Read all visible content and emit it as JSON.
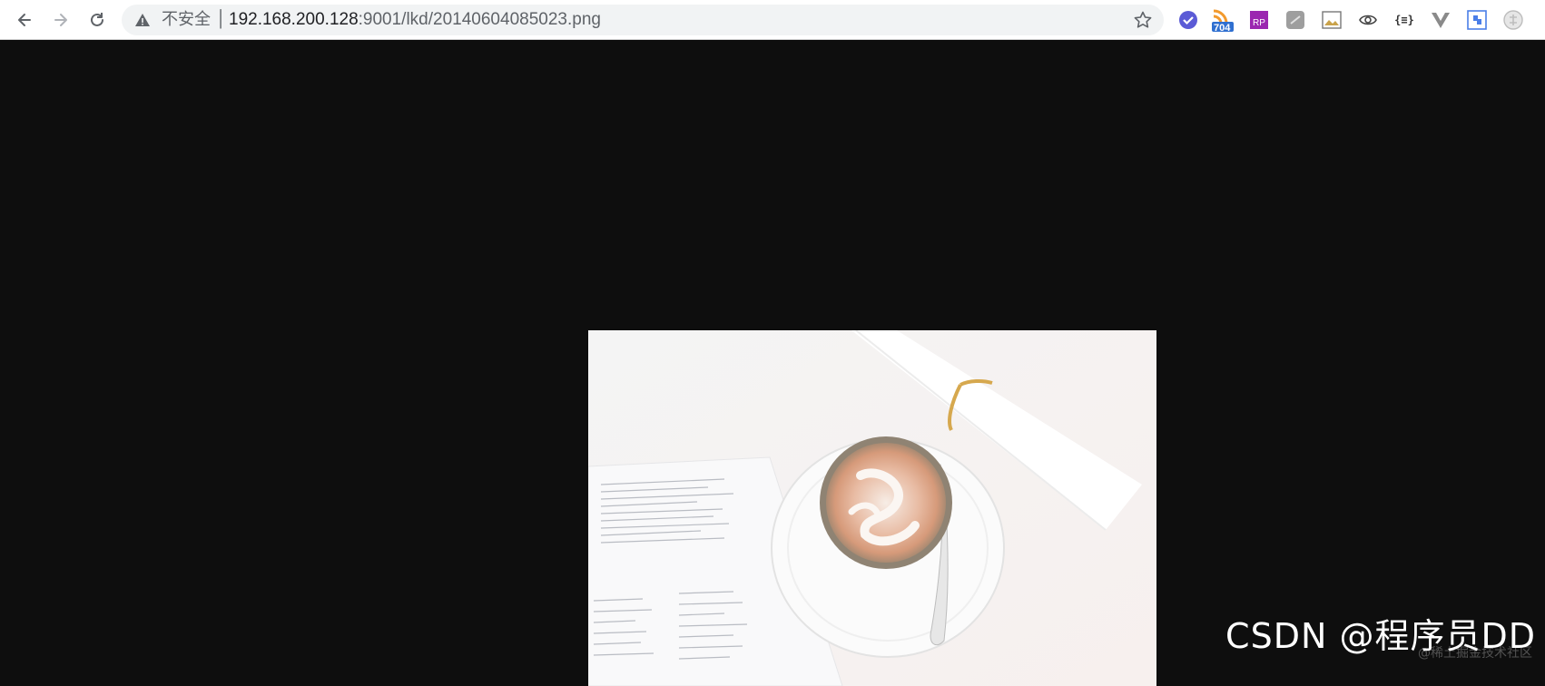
{
  "browser": {
    "security_label": "不安全",
    "url_host": "192.168.200.128",
    "url_path": ":9001/lkd/20140604085023.png",
    "nav_icons": [
      "back-arrow-icon",
      "forward-arrow-icon",
      "reload-icon"
    ],
    "bookmark_icon": "star-icon",
    "extensions": [
      {
        "name": "extension-check-icon",
        "color": "#5b5bd6"
      },
      {
        "name": "extension-rss-icon",
        "badge": "704",
        "color": "#f29a2e"
      },
      {
        "name": "extension-rp-icon",
        "color": "#9b27b0"
      },
      {
        "name": "extension-gray-icon",
        "color": "#9e9e9e"
      },
      {
        "name": "extension-image-icon",
        "color": "#c9a24a"
      },
      {
        "name": "extension-eye-icon",
        "color": "#444444"
      },
      {
        "name": "extension-json-icon",
        "label": "{≡}",
        "color": "#333333"
      },
      {
        "name": "extension-vue-icon",
        "color": "#8a8a8a"
      },
      {
        "name": "extension-puzzle-icon",
        "color": "#4a7ee8"
      },
      {
        "name": "extension-circle-icon",
        "color": "#bdbdbd"
      }
    ]
  },
  "colors": {
    "viewer_background": "#0e0e0e",
    "toolbar_background": "#ffffff",
    "omnibox_background": "#f1f3f4"
  },
  "watermark": {
    "primary": "CSDN @程序员DD",
    "secondary": "@稀土掘金技术社区"
  }
}
